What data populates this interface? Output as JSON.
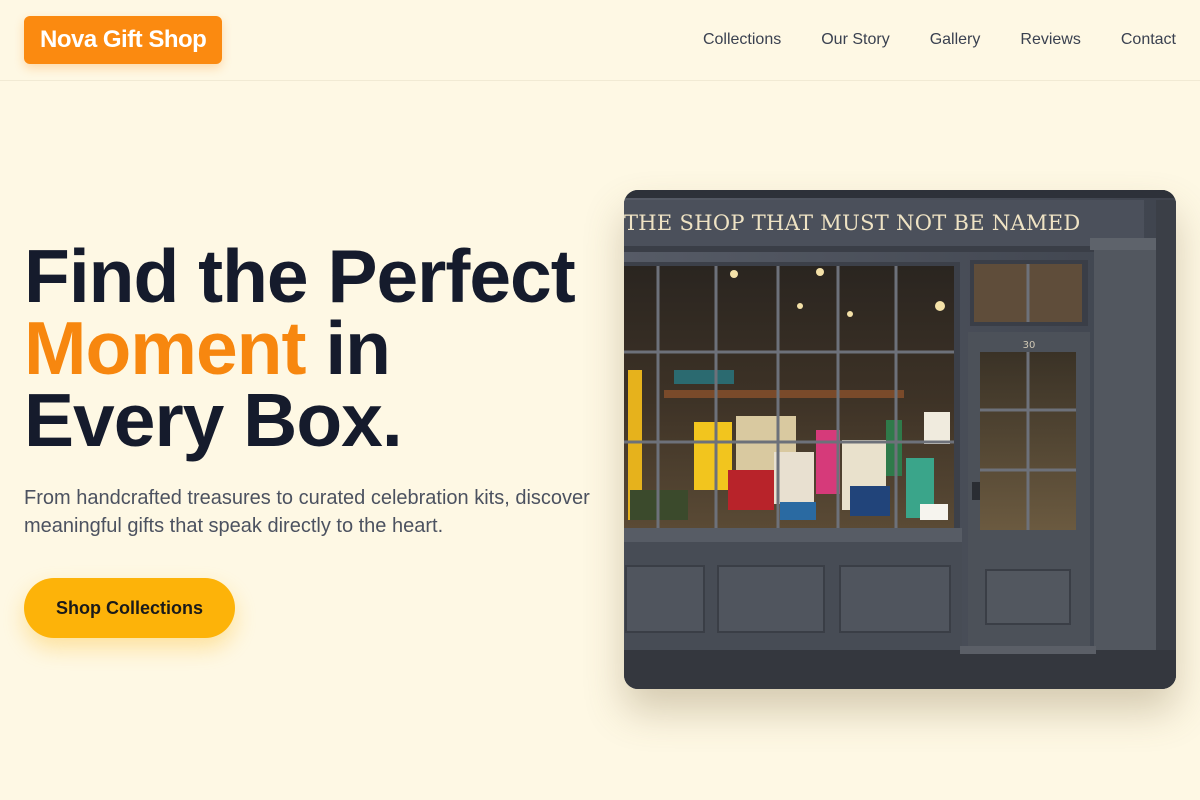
{
  "brand": {
    "name": "Nova Gift Shop"
  },
  "nav": {
    "items": [
      {
        "label": "Collections"
      },
      {
        "label": "Our Story"
      },
      {
        "label": "Gallery"
      },
      {
        "label": "Reviews"
      },
      {
        "label": "Contact"
      }
    ]
  },
  "hero": {
    "title_line1": "Find the Perfect",
    "title_accent": "Moment",
    "title_after_accent": "in",
    "title_line3": "Every Box.",
    "subtitle": "From handcrafted treasures to curated celebration kits, discover meaningful gifts that speak directly to the heart.",
    "cta_label": "Shop Collections"
  },
  "storefront": {
    "sign": "THE SHOP THAT MUST NOT BE NAMED",
    "door_number": "30"
  },
  "colors": {
    "background": "#fef8e4",
    "brand": "#fb8a10",
    "accent_text": "#f7870f",
    "cta": "#fdb309",
    "heading": "#151b2c",
    "storefront_paint": "#4a4f5a"
  }
}
